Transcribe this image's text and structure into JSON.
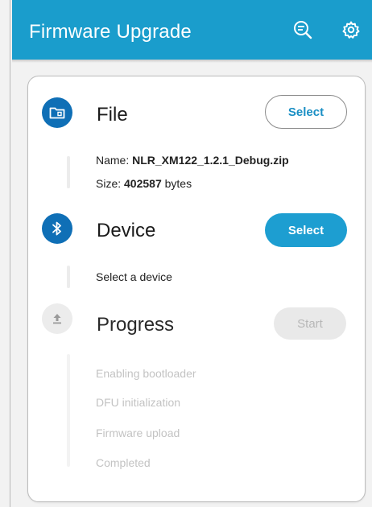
{
  "appbar": {
    "title": "Firmware Upgrade",
    "icons": [
      "search-list-icon",
      "settings-gear-icon"
    ],
    "background": "#1a9dcc"
  },
  "file_step": {
    "title": "File",
    "icon": "folder-icon",
    "button_label": "Select",
    "name_label": "Name: ",
    "name_value": "NLR_XM122_1.2.1_Debug.zip",
    "size_label": "Size: ",
    "size_value": "402587",
    "size_unit": " bytes"
  },
  "device_step": {
    "title": "Device",
    "icon": "bluetooth-icon",
    "button_label": "Select",
    "status": "Select a device"
  },
  "progress_step": {
    "title": "Progress",
    "icon": "upload-icon",
    "button_label": "Start",
    "stages": [
      "Enabling bootloader",
      "DFU initialization",
      "Firmware upload",
      "Completed"
    ]
  },
  "colors": {
    "accent": "#1d9ed1",
    "active_icon": "#0f6fb6",
    "disabled_text": "#c3c3c3"
  }
}
